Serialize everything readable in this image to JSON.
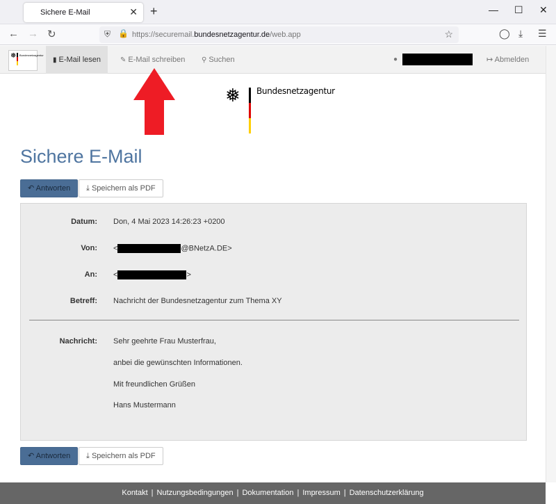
{
  "browser": {
    "tab_title": "Sichere E-Mail",
    "tab_close": "✕",
    "new_tab": "+",
    "url_prefix": "https://securemail.",
    "url_domain": "bundesnetzagentur.de",
    "url_path": "/web.app"
  },
  "nav": {
    "read": "E-Mail lesen",
    "write": "E-Mail schreiben",
    "search": "Suchen",
    "logout": "Abmelden"
  },
  "brand": {
    "name": "Bundesnetzagentur",
    "small_name": "Bundesnetzagentur",
    "colors": {
      "black": "#000000",
      "red": "#dd0000",
      "gold": "#ffce00"
    }
  },
  "page": {
    "title": "Sichere E-Mail"
  },
  "actions": {
    "reply": "Antworten",
    "save_pdf": "Speichern als PDF"
  },
  "message": {
    "date_label": "Datum:",
    "date_value": "Don, 4 Mai 2023 14:26:23 +0200",
    "from_label": "Von:",
    "from_prefix": "<",
    "from_suffix": "@BNetzA.DE>",
    "to_label": "An:",
    "to_prefix": "<",
    "to_suffix": ">",
    "subject_label": "Betreff:",
    "subject_value": "Nachricht der Bundesnetzagentur zum Thema XY",
    "body_label": "Nachricht:",
    "body_lines": [
      "Sehr geehrte Frau Musterfrau,",
      "anbei die gewünschten Informationen.",
      "Mit freundlichen Grüßen",
      "Hans Mustermann"
    ]
  },
  "footer": {
    "links": [
      "Kontakt",
      "Nutzungsbedingungen",
      "Dokumentation",
      "Impressum",
      "Datenschutzerklärung"
    ],
    "separator": "|"
  },
  "icons": {
    "book": "book-icon",
    "pencil": "pencil-icon",
    "search": "search-icon",
    "user": "user-icon",
    "signout": "sign-out-icon",
    "reply": "reply-icon",
    "download": "download-icon"
  },
  "annotation": {
    "arrow_color": "#ee1c25"
  }
}
